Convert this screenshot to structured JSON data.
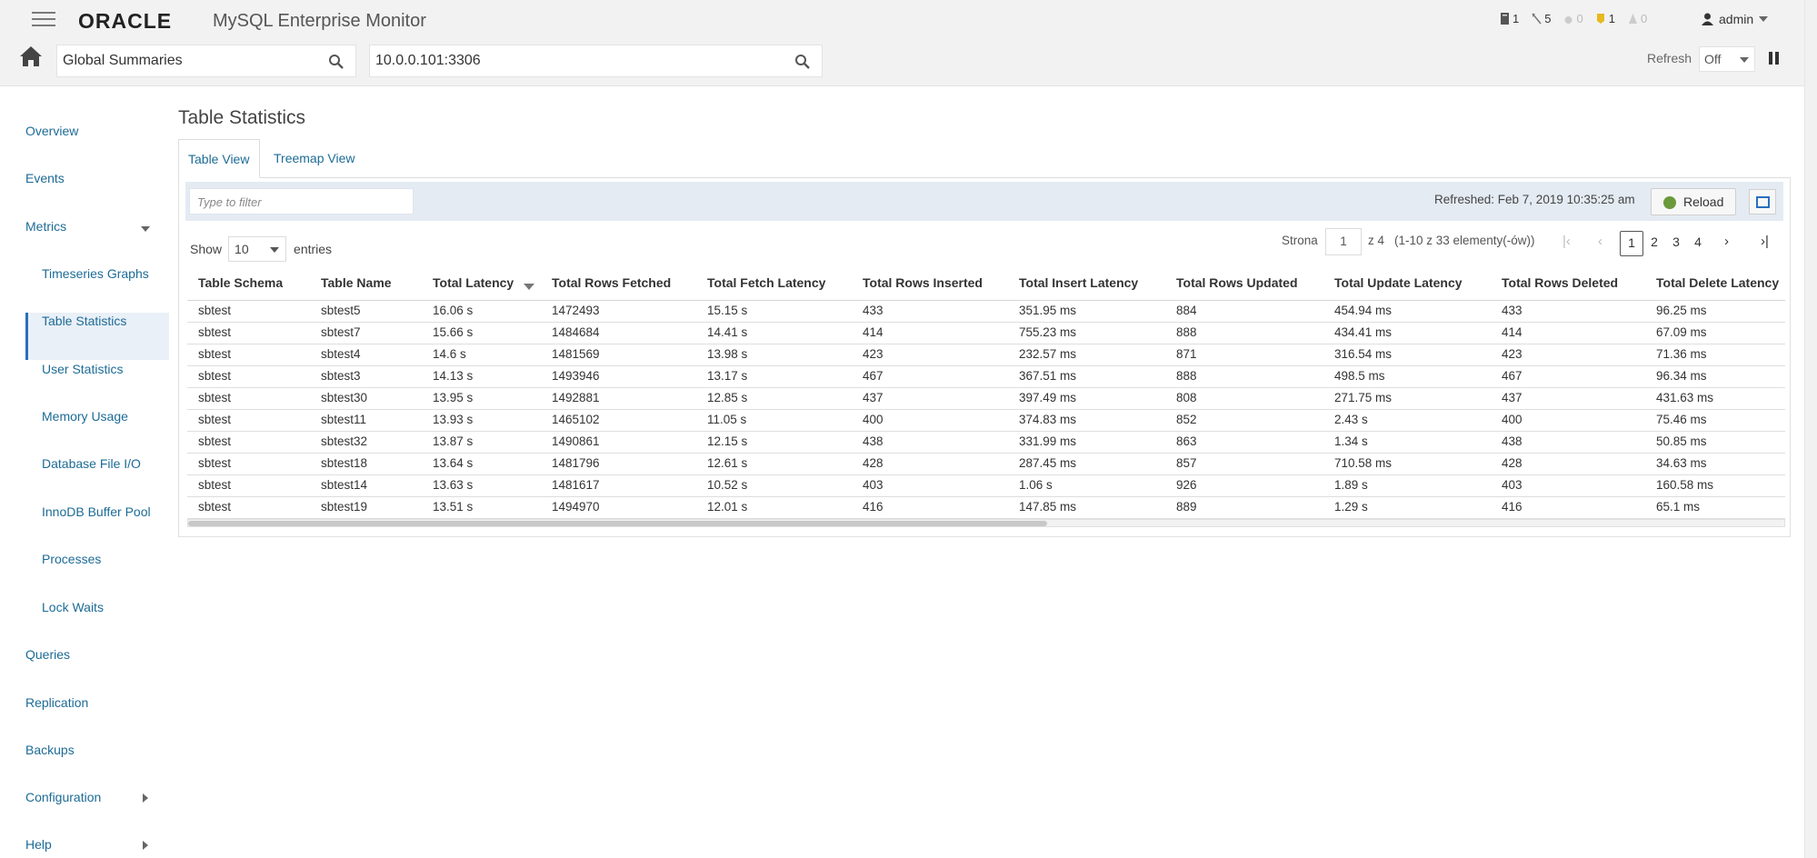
{
  "header": {
    "brand": "ORACLE",
    "app_title": "MySQL Enterprise Monitor",
    "status": [
      {
        "icon": "server-icon",
        "count": "1"
      },
      {
        "icon": "alert-icon",
        "count": "5"
      },
      {
        "icon": "emergency-icon",
        "count": "0"
      },
      {
        "icon": "critical-icon",
        "count": "1"
      },
      {
        "icon": "warning-icon",
        "count": "0"
      }
    ],
    "user": "admin",
    "group_search": "Global Summaries",
    "instance_search": "10.0.0.101:3306",
    "refresh_label": "Refresh",
    "refresh_value": "Off"
  },
  "sidebar": {
    "items": [
      "Overview",
      "Events",
      "Metrics",
      "Timeseries Graphs",
      "Table Statistics",
      "User Statistics",
      "Memory Usage",
      "Database File I/O",
      "InnoDB Buffer Pool",
      "Processes",
      "Lock Waits",
      "Queries",
      "Replication",
      "Backups",
      "Configuration",
      "Help"
    ]
  },
  "main": {
    "title": "Table Statistics",
    "tabs": [
      "Table View",
      "Treemap View"
    ],
    "filter_placeholder": "Type to filter",
    "refreshed": "Refreshed: Feb 7, 2019 10:35:25 am",
    "reload_label": "Reload",
    "show_label": "Show",
    "entries_value": "10",
    "entries_label": "entries",
    "pager": {
      "page_label": "Strona",
      "page_value": "1",
      "of_label": "z 4",
      "range_label": "(1-10 z 33 elementy(-ów))",
      "pages": [
        "1",
        "2",
        "3",
        "4"
      ]
    },
    "columns": [
      "Table Schema",
      "Table Name",
      "Total Latency",
      "Total Rows Fetched",
      "Total Fetch Latency",
      "Total Rows Inserted",
      "Total Insert Latency",
      "Total Rows Updated",
      "Total Update Latency",
      "Total Rows Deleted",
      "Total Delete Latency"
    ],
    "rows": [
      [
        "sbtest",
        "sbtest5",
        "16.06 s",
        "1472493",
        "15.15 s",
        "433",
        "351.95 ms",
        "884",
        "454.94 ms",
        "433",
        "96.25 ms"
      ],
      [
        "sbtest",
        "sbtest7",
        "15.66 s",
        "1484684",
        "14.41 s",
        "414",
        "755.23 ms",
        "888",
        "434.41 ms",
        "414",
        "67.09 ms"
      ],
      [
        "sbtest",
        "sbtest4",
        "14.6 s",
        "1481569",
        "13.98 s",
        "423",
        "232.57 ms",
        "871",
        "316.54 ms",
        "423",
        "71.36 ms"
      ],
      [
        "sbtest",
        "sbtest3",
        "14.13 s",
        "1493946",
        "13.17 s",
        "467",
        "367.51 ms",
        "888",
        "498.5 ms",
        "467",
        "96.34 ms"
      ],
      [
        "sbtest",
        "sbtest30",
        "13.95 s",
        "1492881",
        "12.85 s",
        "437",
        "397.49 ms",
        "808",
        "271.75 ms",
        "437",
        "431.63 ms"
      ],
      [
        "sbtest",
        "sbtest11",
        "13.93 s",
        "1465102",
        "11.05 s",
        "400",
        "374.83 ms",
        "852",
        "2.43 s",
        "400",
        "75.46 ms"
      ],
      [
        "sbtest",
        "sbtest32",
        "13.87 s",
        "1490861",
        "12.15 s",
        "438",
        "331.99 ms",
        "863",
        "1.34 s",
        "438",
        "50.85 ms"
      ],
      [
        "sbtest",
        "sbtest18",
        "13.64 s",
        "1481796",
        "12.61 s",
        "428",
        "287.45 ms",
        "857",
        "710.58 ms",
        "428",
        "34.63 ms"
      ],
      [
        "sbtest",
        "sbtest14",
        "13.63 s",
        "1481617",
        "10.52 s",
        "403",
        "1.06 s",
        "926",
        "1.89 s",
        "403",
        "160.58 ms"
      ],
      [
        "sbtest",
        "sbtest19",
        "13.51 s",
        "1494970",
        "12.01 s",
        "416",
        "147.85 ms",
        "889",
        "1.29 s",
        "416",
        "65.1 ms"
      ]
    ]
  }
}
